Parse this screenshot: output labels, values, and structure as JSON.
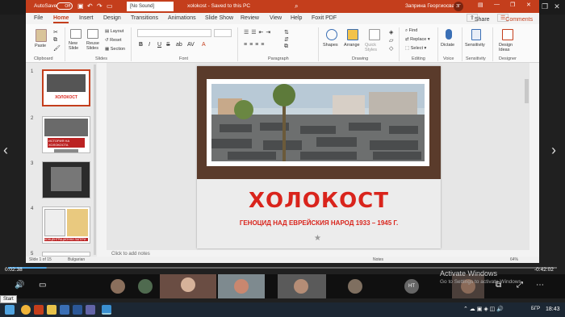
{
  "window": {
    "autosave_label": "AutoSave",
    "autosave_state": "Off",
    "sound_selector": "[No Sound]",
    "doc_title": "xolokost  -  Saved to this PC",
    "user_name": "Заприна Георгиосва",
    "share_label": "Share",
    "comments_label": "Comments"
  },
  "tabs": [
    "File",
    "Home",
    "Insert",
    "Design",
    "Transitions",
    "Animations",
    "Slide Show",
    "Review",
    "View",
    "Help",
    "Foxit PDF"
  ],
  "active_tab": "Home",
  "ribbon": {
    "clipboard": {
      "paste": "Paste",
      "label": "Clipboard"
    },
    "slides": {
      "new_slide": "New Slide",
      "reuse": "Reuse Slides",
      "layout": "Layout",
      "reset": "Reset",
      "section": "Section",
      "label": "Slides"
    },
    "font": {
      "label": "Font",
      "bold": "B",
      "italic": "I",
      "underline": "U",
      "strike": "S",
      "shadow": "ab",
      "aa": "AV"
    },
    "paragraph": {
      "label": "Paragraph"
    },
    "drawing": {
      "shapes": "Shapes",
      "arrange": "Arrange",
      "quick_styles": "Quick Styles",
      "label": "Drawing"
    },
    "editing": {
      "find": "Find",
      "replace": "Replace",
      "select": "Select",
      "label": "Editing"
    },
    "voice": {
      "dictate": "Dictate",
      "label": "Voice"
    },
    "sensitivity": {
      "sensitivity": "Sensitivity",
      "label": "Sensitivity"
    },
    "designer": {
      "design_ideas": "Design Ideas",
      "label": "Designer"
    }
  },
  "thumbnails": [
    {
      "num": "1",
      "title": "ХОЛОКОСТ"
    },
    {
      "num": "2",
      "title": "ИСТОРИЯ НА ХОЛОКОСТА"
    },
    {
      "num": "3",
      "title": ""
    },
    {
      "num": "4",
      "title": "КОНЦЕНТРАЦИОННИ ЛАГЕРИ"
    },
    {
      "num": "5",
      "title": ""
    }
  ],
  "slide": {
    "title": "ХОЛОКОСТ",
    "subtitle": "ГЕНОЦИД НАД ЕВРЕЙСКИЯ НАРОД 1933 – 1945 Г."
  },
  "notes_placeholder": "Click to add notes",
  "status": {
    "slide_of": "Slide 1 of 15",
    "language": "Bulgarian",
    "notes": "Notes",
    "zoom": "64%"
  },
  "player": {
    "elapsed": "0:02:38",
    "remaining": "-0:42:02",
    "progress_fraction": 0.07
  },
  "participants": [
    {
      "initials": "",
      "name": ""
    },
    {
      "initials": "",
      "name": ""
    },
    {
      "initials": "НТ",
      "name": "Николай Т..."
    },
    {
      "initials": "",
      "name": ""
    }
  ],
  "watermark": {
    "line1": "Activate Windows",
    "line2": "Go to Settings to activate Windows."
  },
  "taskbar": {
    "start_tip": "Start",
    "lang": "БГР",
    "time": "18:43"
  },
  "colors": {
    "ppt_accent": "#c43e1c",
    "slide_title": "#d9241c",
    "taskbar": "#1c2733"
  }
}
